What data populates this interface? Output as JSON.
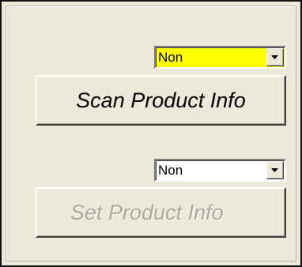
{
  "scan": {
    "select_value": "Non",
    "select_bg": "#ffff00",
    "button_label": "Scan Product Info",
    "button_enabled": true
  },
  "set": {
    "select_value": "Non",
    "select_bg": "#ffffff",
    "button_label": "Set Product Info",
    "button_enabled": false
  },
  "icons": {
    "dropdown": "chevron-down-icon"
  }
}
